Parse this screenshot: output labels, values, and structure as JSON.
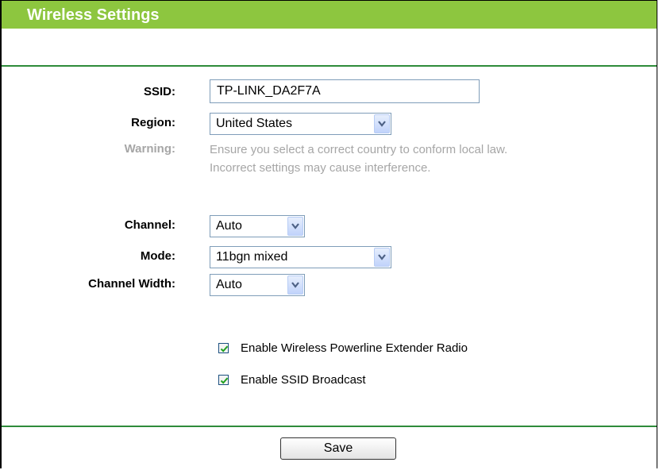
{
  "header": {
    "title": "Wireless Settings"
  },
  "form": {
    "ssid_label": "SSID:",
    "ssid_value": "TP-LINK_DA2F7A",
    "region_label": "Region:",
    "region_value": "United States",
    "warning_label": "Warning:",
    "warning_line1": "Ensure you select a correct country to conform local law.",
    "warning_line2": "Incorrect settings may cause interference.",
    "channel_label": "Channel:",
    "channel_value": "Auto",
    "mode_label": "Mode:",
    "mode_value": "11bgn mixed",
    "width_label": "Channel Width:",
    "width_value": "Auto",
    "extender_label": "Enable Wireless Powerline Extender Radio",
    "extender_checked": true,
    "broadcast_label": "Enable SSID Broadcast",
    "broadcast_checked": true
  },
  "footer": {
    "save_label": "Save"
  },
  "colors": {
    "title_bar": "#8dc63f",
    "divider": "#2e8b3a",
    "warning_text": "#a6a6a6"
  },
  "icons": {
    "select_arrow": "chevron-down-icon",
    "check": "checkmark-icon"
  }
}
